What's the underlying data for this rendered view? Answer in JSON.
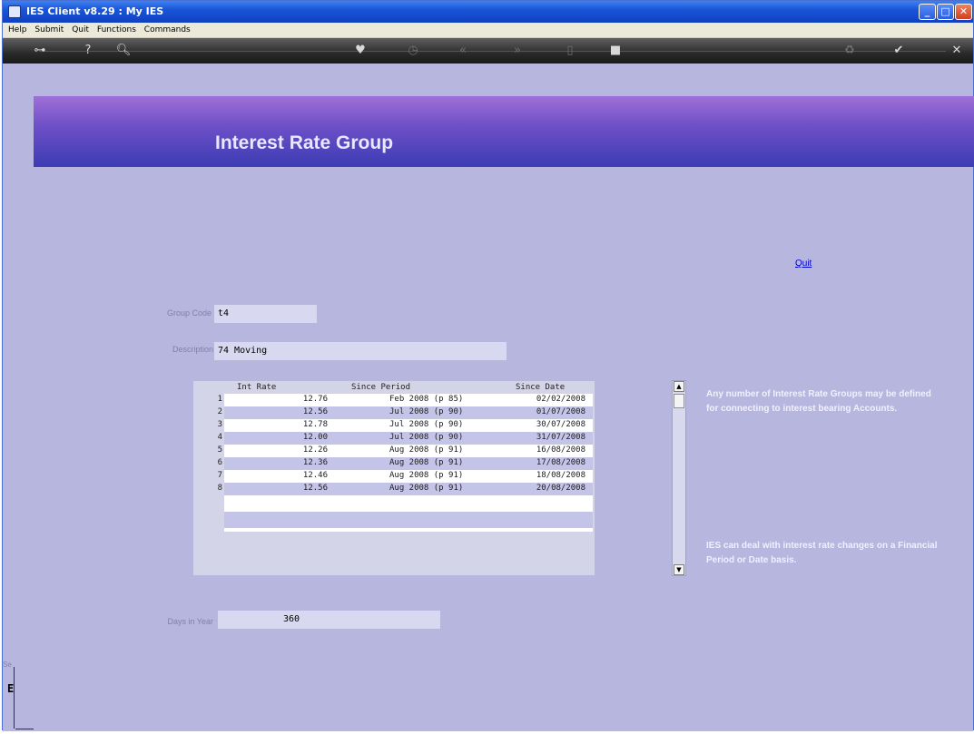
{
  "window": {
    "title": "IES Client v8.29 : My IES"
  },
  "menu": [
    "Help",
    "Submit",
    "Quit",
    "Functions",
    "Commands"
  ],
  "toolbar_icons": [
    "key-icon",
    "help-icon",
    "search-icon",
    "heart-icon",
    "clock-icon",
    "rewind-icon",
    "forward-icon",
    "stop-icon",
    "square-icon",
    "recycle-icon",
    "check-icon",
    "close-icon"
  ],
  "page": {
    "title": "Interest Rate Group",
    "quit_link": "Quit"
  },
  "form": {
    "group_code_label": "Group Code",
    "group_code_value": "t4",
    "description_label": "Description",
    "description_value": "74 Moving",
    "days_label": "Days in Year",
    "days_value": "360"
  },
  "grid": {
    "columns": [
      "Int Rate",
      "Since Period",
      "Since Date"
    ],
    "rows": [
      {
        "num": "1",
        "rate": "12.76",
        "period": "Feb 2008 (p 85)",
        "date": "02/02/2008"
      },
      {
        "num": "2",
        "rate": "12.56",
        "period": "Jul 2008 (p 90)",
        "date": "01/07/2008"
      },
      {
        "num": "3",
        "rate": "12.78",
        "period": "Jul 2008 (p 90)",
        "date": "30/07/2008"
      },
      {
        "num": "4",
        "rate": "12.00",
        "period": "Jul 2008 (p 90)",
        "date": "31/07/2008"
      },
      {
        "num": "5",
        "rate": "12.26",
        "period": "Aug 2008 (p 91)",
        "date": "16/08/2008"
      },
      {
        "num": "6",
        "rate": "12.36",
        "period": "Aug 2008 (p 91)",
        "date": "17/08/2008"
      },
      {
        "num": "7",
        "rate": "12.46",
        "period": "Aug 2008 (p 91)",
        "date": "18/08/2008"
      },
      {
        "num": "8",
        "rate": "12.56",
        "period": "Aug 2008 (p 91)",
        "date": "20/08/2008"
      }
    ]
  },
  "help": {
    "text1": "Any number of Interest Rate Groups may be defined for connecting to interest bearing Accounts.",
    "text2": "IES can deal with interest rate changes on a Financial Period or Date basis."
  },
  "sidebar": {
    "label": "Se",
    "letter": "E"
  }
}
